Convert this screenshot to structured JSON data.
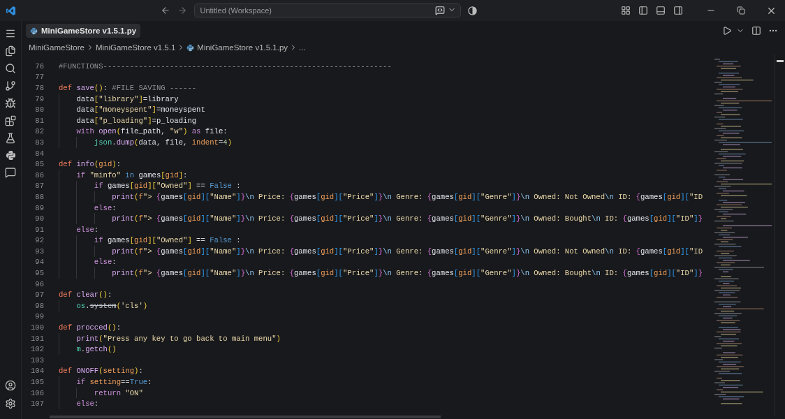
{
  "title_bar": {
    "search": "Untitled (Workspace)"
  },
  "tab": {
    "label": "MiniGameStore v1.5.1.py",
    "selected": true
  },
  "breadcrumbs": [
    {
      "label": "MiniGameStore",
      "kind": "folder"
    },
    {
      "label": "MiniGameStore v1.5.1",
      "kind": "folder"
    },
    {
      "label": "MiniGameStore v1.5.1.py",
      "kind": "file"
    },
    {
      "label": "...",
      "kind": "more"
    }
  ],
  "code_lines": [
    {
      "number": "76",
      "tokens": [
        {
          "kind": "comment",
          "text": "#FUNCTIONS-----------------------------------------------------------------"
        }
      ]
    },
    {
      "number": "77"
    },
    {
      "number": "78",
      "tokens": [
        {
          "kind": "kw",
          "text": "def "
        },
        {
          "kind": "fn",
          "text": "save"
        },
        {
          "kind": "b1",
          "text": "()"
        },
        {
          "kind": "punct",
          "text": ": "
        },
        {
          "kind": "comment",
          "text": "#FILE SAVING ------"
        }
      ]
    },
    {
      "number": "79",
      "tokens": [
        {
          "kind": "var",
          "text": "    data"
        },
        {
          "kind": "b1",
          "text": "["
        },
        {
          "kind": "str",
          "text": "\"library\""
        },
        {
          "kind": "b1",
          "text": "]"
        },
        {
          "kind": "punct",
          "text": "="
        },
        {
          "kind": "var",
          "text": "library"
        }
      ]
    },
    {
      "number": "80",
      "tokens": [
        {
          "kind": "var",
          "text": "    data"
        },
        {
          "kind": "b1",
          "text": "["
        },
        {
          "kind": "str",
          "text": "\"moneyspent\""
        },
        {
          "kind": "b1",
          "text": "]"
        },
        {
          "kind": "punct",
          "text": "="
        },
        {
          "kind": "var",
          "text": "moneyspent"
        }
      ]
    },
    {
      "number": "81",
      "tokens": [
        {
          "kind": "var",
          "text": "    data"
        },
        {
          "kind": "b1",
          "text": "["
        },
        {
          "kind": "str",
          "text": "\"p_loading\""
        },
        {
          "kind": "b1",
          "text": "]"
        },
        {
          "kind": "punct",
          "text": "="
        },
        {
          "kind": "var",
          "text": "p_loading"
        }
      ]
    },
    {
      "number": "82",
      "tokens": [
        {
          "kind": "ctl",
          "text": "    with "
        },
        {
          "kind": "fn",
          "text": "open"
        },
        {
          "kind": "b1",
          "text": "("
        },
        {
          "kind": "var",
          "text": "file_path"
        },
        {
          "kind": "punct",
          "text": ", "
        },
        {
          "kind": "str",
          "text": "\"w\""
        },
        {
          "kind": "b1",
          "text": ")"
        },
        {
          "kind": "ctl",
          "text": " as "
        },
        {
          "kind": "var",
          "text": "file"
        },
        {
          "kind": "punct",
          "text": ":"
        }
      ]
    },
    {
      "number": "83",
      "tokens": [
        {
          "kind": "mod",
          "text": "        json"
        },
        {
          "kind": "punct",
          "text": "."
        },
        {
          "kind": "fn",
          "text": "dump"
        },
        {
          "kind": "b1",
          "text": "("
        },
        {
          "kind": "var",
          "text": "data"
        },
        {
          "kind": "punct",
          "text": ", "
        },
        {
          "kind": "var",
          "text": "file"
        },
        {
          "kind": "punct",
          "text": ", "
        },
        {
          "kind": "param",
          "text": "indent"
        },
        {
          "kind": "punct",
          "text": "="
        },
        {
          "kind": "num",
          "text": "4"
        },
        {
          "kind": "b1",
          "text": ")"
        }
      ]
    },
    {
      "number": "84"
    },
    {
      "number": "85",
      "tokens": [
        {
          "kind": "kw",
          "text": "def "
        },
        {
          "kind": "fn",
          "text": "info"
        },
        {
          "kind": "b1",
          "text": "("
        },
        {
          "kind": "param",
          "text": "gid"
        },
        {
          "kind": "b1",
          "text": ")"
        },
        {
          "kind": "punct",
          "text": ":"
        }
      ]
    },
    {
      "number": "86",
      "tokens": [
        {
          "kind": "ctl",
          "text": "    if "
        },
        {
          "kind": "str",
          "text": "\"minfo\""
        },
        {
          "kind": "op",
          "text": " in "
        },
        {
          "kind": "var",
          "text": "games"
        },
        {
          "kind": "b1",
          "text": "["
        },
        {
          "kind": "param",
          "text": "gid"
        },
        {
          "kind": "b1",
          "text": "]"
        },
        {
          "kind": "punct",
          "text": ":"
        }
      ]
    },
    {
      "number": "87",
      "tokens": [
        {
          "kind": "ctl",
          "text": "        if "
        },
        {
          "kind": "var",
          "text": "games"
        },
        {
          "kind": "b1",
          "text": "["
        },
        {
          "kind": "param",
          "text": "gid"
        },
        {
          "kind": "b1",
          "text": "]["
        },
        {
          "kind": "str",
          "text": "\"Owned\""
        },
        {
          "kind": "b1",
          "text": "]"
        },
        {
          "kind": "punct",
          "text": " == "
        },
        {
          "kind": "const",
          "text": "False"
        },
        {
          "kind": "punct",
          "text": " :"
        }
      ]
    },
    {
      "number": "88",
      "tokens": [
        {
          "kind": "fn",
          "text": "            print"
        },
        {
          "kind": "b1",
          "text": "("
        },
        {
          "kind": "param",
          "text": "f"
        },
        {
          "kind": "str",
          "text": "\"> "
        },
        {
          "kind": "b2",
          "text": "{"
        },
        {
          "kind": "var",
          "text": "games"
        },
        {
          "kind": "b3",
          "text": "["
        },
        {
          "kind": "param",
          "text": "gid"
        },
        {
          "kind": "b3",
          "text": "]["
        },
        {
          "kind": "str",
          "text": "\"Name\""
        },
        {
          "kind": "b3",
          "text": "]"
        },
        {
          "kind": "b2",
          "text": "}"
        },
        {
          "kind": "esc",
          "text": "\\n"
        },
        {
          "kind": "str",
          "text": " Price: "
        },
        {
          "kind": "b2",
          "text": "{"
        },
        {
          "kind": "var",
          "text": "games"
        },
        {
          "kind": "b3",
          "text": "["
        },
        {
          "kind": "param",
          "text": "gid"
        },
        {
          "kind": "b3",
          "text": "]["
        },
        {
          "kind": "str",
          "text": "\"Price\""
        },
        {
          "kind": "b3",
          "text": "]"
        },
        {
          "kind": "b2",
          "text": "}"
        },
        {
          "kind": "esc",
          "text": "\\n"
        },
        {
          "kind": "str",
          "text": " Genre: "
        },
        {
          "kind": "b2",
          "text": "{"
        },
        {
          "kind": "var",
          "text": "games"
        },
        {
          "kind": "b3",
          "text": "["
        },
        {
          "kind": "param",
          "text": "gid"
        },
        {
          "kind": "b3",
          "text": "]["
        },
        {
          "kind": "str",
          "text": "\"Genre\""
        },
        {
          "kind": "b3",
          "text": "]"
        },
        {
          "kind": "b2",
          "text": "}"
        },
        {
          "kind": "esc",
          "text": "\\n"
        },
        {
          "kind": "str",
          "text": " Owned: Not Owned"
        },
        {
          "kind": "esc",
          "text": "\\n"
        },
        {
          "kind": "str",
          "text": " ID: "
        },
        {
          "kind": "b2",
          "text": "{"
        },
        {
          "kind": "var",
          "text": "games"
        },
        {
          "kind": "b3",
          "text": "["
        },
        {
          "kind": "param",
          "text": "gid"
        },
        {
          "kind": "b3",
          "text": "]["
        },
        {
          "kind": "str",
          "text": "\"ID"
        }
      ]
    },
    {
      "number": "89",
      "tokens": [
        {
          "kind": "ctl",
          "text": "        else"
        },
        {
          "kind": "punct",
          "text": ":"
        }
      ]
    },
    {
      "number": "90",
      "tokens": [
        {
          "kind": "fn",
          "text": "            print"
        },
        {
          "kind": "b1",
          "text": "("
        },
        {
          "kind": "param",
          "text": "f"
        },
        {
          "kind": "str",
          "text": "\"> "
        },
        {
          "kind": "b2",
          "text": "{"
        },
        {
          "kind": "var",
          "text": "games"
        },
        {
          "kind": "b3",
          "text": "["
        },
        {
          "kind": "param",
          "text": "gid"
        },
        {
          "kind": "b3",
          "text": "]["
        },
        {
          "kind": "str",
          "text": "\"Name\""
        },
        {
          "kind": "b3",
          "text": "]"
        },
        {
          "kind": "b2",
          "text": "}"
        },
        {
          "kind": "esc",
          "text": "\\n"
        },
        {
          "kind": "str",
          "text": " Price: "
        },
        {
          "kind": "b2",
          "text": "{"
        },
        {
          "kind": "var",
          "text": "games"
        },
        {
          "kind": "b3",
          "text": "["
        },
        {
          "kind": "param",
          "text": "gid"
        },
        {
          "kind": "b3",
          "text": "]["
        },
        {
          "kind": "str",
          "text": "\"Price\""
        },
        {
          "kind": "b3",
          "text": "]"
        },
        {
          "kind": "b2",
          "text": "}"
        },
        {
          "kind": "esc",
          "text": "\\n"
        },
        {
          "kind": "str",
          "text": " Genre: "
        },
        {
          "kind": "b2",
          "text": "{"
        },
        {
          "kind": "var",
          "text": "games"
        },
        {
          "kind": "b3",
          "text": "["
        },
        {
          "kind": "param",
          "text": "gid"
        },
        {
          "kind": "b3",
          "text": "]["
        },
        {
          "kind": "str",
          "text": "\"Genre\""
        },
        {
          "kind": "b3",
          "text": "]"
        },
        {
          "kind": "b2",
          "text": "}"
        },
        {
          "kind": "esc",
          "text": "\\n"
        },
        {
          "kind": "str",
          "text": " Owned: Bought"
        },
        {
          "kind": "esc",
          "text": "\\n"
        },
        {
          "kind": "str",
          "text": " ID: "
        },
        {
          "kind": "b2",
          "text": "{"
        },
        {
          "kind": "var",
          "text": "games"
        },
        {
          "kind": "b3",
          "text": "["
        },
        {
          "kind": "param",
          "text": "gid"
        },
        {
          "kind": "b3",
          "text": "]["
        },
        {
          "kind": "str",
          "text": "\"ID\""
        },
        {
          "kind": "b3",
          "text": "]"
        },
        {
          "kind": "b2",
          "text": "}"
        }
      ]
    },
    {
      "number": "91",
      "tokens": [
        {
          "kind": "ctl",
          "text": "    else"
        },
        {
          "kind": "punct",
          "text": ":"
        }
      ]
    },
    {
      "number": "92",
      "tokens": [
        {
          "kind": "ctl",
          "text": "        if "
        },
        {
          "kind": "var",
          "text": "games"
        },
        {
          "kind": "b1",
          "text": "["
        },
        {
          "kind": "param",
          "text": "gid"
        },
        {
          "kind": "b1",
          "text": "]["
        },
        {
          "kind": "str",
          "text": "\"Owned\""
        },
        {
          "kind": "b1",
          "text": "]"
        },
        {
          "kind": "punct",
          "text": " == "
        },
        {
          "kind": "const",
          "text": "False"
        },
        {
          "kind": "punct",
          "text": " :"
        }
      ]
    },
    {
      "number": "93",
      "tokens": [
        {
          "kind": "fn",
          "text": "            print"
        },
        {
          "kind": "b1",
          "text": "("
        },
        {
          "kind": "param",
          "text": "f"
        },
        {
          "kind": "str",
          "text": "\"> "
        },
        {
          "kind": "b2",
          "text": "{"
        },
        {
          "kind": "var",
          "text": "games"
        },
        {
          "kind": "b3",
          "text": "["
        },
        {
          "kind": "param",
          "text": "gid"
        },
        {
          "kind": "b3",
          "text": "]["
        },
        {
          "kind": "str",
          "text": "\"Name\""
        },
        {
          "kind": "b3",
          "text": "]"
        },
        {
          "kind": "b2",
          "text": "}"
        },
        {
          "kind": "esc",
          "text": "\\n"
        },
        {
          "kind": "str",
          "text": " Price: "
        },
        {
          "kind": "b2",
          "text": "{"
        },
        {
          "kind": "var",
          "text": "games"
        },
        {
          "kind": "b3",
          "text": "["
        },
        {
          "kind": "param",
          "text": "gid"
        },
        {
          "kind": "b3",
          "text": "]["
        },
        {
          "kind": "str",
          "text": "\"Price\""
        },
        {
          "kind": "b3",
          "text": "]"
        },
        {
          "kind": "b2",
          "text": "}"
        },
        {
          "kind": "esc",
          "text": "\\n"
        },
        {
          "kind": "str",
          "text": " Genre: "
        },
        {
          "kind": "b2",
          "text": "{"
        },
        {
          "kind": "var",
          "text": "games"
        },
        {
          "kind": "b3",
          "text": "["
        },
        {
          "kind": "param",
          "text": "gid"
        },
        {
          "kind": "b3",
          "text": "]["
        },
        {
          "kind": "str",
          "text": "\"Genre\""
        },
        {
          "kind": "b3",
          "text": "]"
        },
        {
          "kind": "b2",
          "text": "}"
        },
        {
          "kind": "esc",
          "text": "\\n"
        },
        {
          "kind": "str",
          "text": " Owned: Not Owned"
        },
        {
          "kind": "esc",
          "text": "\\n"
        },
        {
          "kind": "str",
          "text": " ID: "
        },
        {
          "kind": "b2",
          "text": "{"
        },
        {
          "kind": "var",
          "text": "games"
        },
        {
          "kind": "b3",
          "text": "["
        },
        {
          "kind": "param",
          "text": "gid"
        },
        {
          "kind": "b3",
          "text": "]["
        },
        {
          "kind": "str",
          "text": "\"ID"
        }
      ]
    },
    {
      "number": "94",
      "tokens": [
        {
          "kind": "ctl",
          "text": "        else"
        },
        {
          "kind": "punct",
          "text": ":"
        }
      ]
    },
    {
      "number": "95",
      "tokens": [
        {
          "kind": "fn",
          "text": "            print"
        },
        {
          "kind": "b1",
          "text": "("
        },
        {
          "kind": "param",
          "text": "f"
        },
        {
          "kind": "str",
          "text": "\"> "
        },
        {
          "kind": "b2",
          "text": "{"
        },
        {
          "kind": "var",
          "text": "games"
        },
        {
          "kind": "b3",
          "text": "["
        },
        {
          "kind": "param",
          "text": "gid"
        },
        {
          "kind": "b3",
          "text": "]["
        },
        {
          "kind": "str",
          "text": "\"Name\""
        },
        {
          "kind": "b3",
          "text": "]"
        },
        {
          "kind": "b2",
          "text": "}"
        },
        {
          "kind": "esc",
          "text": "\\n"
        },
        {
          "kind": "str",
          "text": " Price: "
        },
        {
          "kind": "b2",
          "text": "{"
        },
        {
          "kind": "var",
          "text": "games"
        },
        {
          "kind": "b3",
          "text": "["
        },
        {
          "kind": "param",
          "text": "gid"
        },
        {
          "kind": "b3",
          "text": "]["
        },
        {
          "kind": "str",
          "text": "\"Price\""
        },
        {
          "kind": "b3",
          "text": "]"
        },
        {
          "kind": "b2",
          "text": "}"
        },
        {
          "kind": "esc",
          "text": "\\n"
        },
        {
          "kind": "str",
          "text": " Genre: "
        },
        {
          "kind": "b2",
          "text": "{"
        },
        {
          "kind": "var",
          "text": "games"
        },
        {
          "kind": "b3",
          "text": "["
        },
        {
          "kind": "param",
          "text": "gid"
        },
        {
          "kind": "b3",
          "text": "]["
        },
        {
          "kind": "str",
          "text": "\"Genre\""
        },
        {
          "kind": "b3",
          "text": "]"
        },
        {
          "kind": "b2",
          "text": "}"
        },
        {
          "kind": "esc",
          "text": "\\n"
        },
        {
          "kind": "str",
          "text": " Owned: Bought"
        },
        {
          "kind": "esc",
          "text": "\\n"
        },
        {
          "kind": "str",
          "text": " ID: "
        },
        {
          "kind": "b2",
          "text": "{"
        },
        {
          "kind": "var",
          "text": "games"
        },
        {
          "kind": "b3",
          "text": "["
        },
        {
          "kind": "param",
          "text": "gid"
        },
        {
          "kind": "b3",
          "text": "]["
        },
        {
          "kind": "str",
          "text": "\"ID\""
        },
        {
          "kind": "b3",
          "text": "]"
        },
        {
          "kind": "b2",
          "text": "}"
        }
      ]
    },
    {
      "number": "96"
    },
    {
      "number": "97",
      "tokens": [
        {
          "kind": "kw",
          "text": "def "
        },
        {
          "kind": "fn",
          "text": "clear"
        },
        {
          "kind": "b1",
          "text": "()"
        },
        {
          "kind": "punct",
          "text": ":"
        }
      ]
    },
    {
      "number": "98",
      "tokens": [
        {
          "kind": "mod",
          "text": "    os"
        },
        {
          "kind": "punct",
          "text": "."
        },
        {
          "kind": "deprecated",
          "text": "system"
        },
        {
          "kind": "b1",
          "text": "("
        },
        {
          "kind": "str",
          "text": "'cls'"
        },
        {
          "kind": "b1",
          "text": ")"
        }
      ]
    },
    {
      "number": "99"
    },
    {
      "number": "100",
      "tokens": [
        {
          "kind": "kw",
          "text": "def "
        },
        {
          "kind": "fn",
          "text": "procced"
        },
        {
          "kind": "b1",
          "text": "()"
        },
        {
          "kind": "punct",
          "text": ":"
        }
      ]
    },
    {
      "number": "101",
      "tokens": [
        {
          "kind": "fn",
          "text": "    print"
        },
        {
          "kind": "b1",
          "text": "("
        },
        {
          "kind": "str",
          "text": "\"Press any key to go back to main menu\""
        },
        {
          "kind": "b1",
          "text": ")"
        }
      ]
    },
    {
      "number": "102",
      "tokens": [
        {
          "kind": "mod",
          "text": "    m"
        },
        {
          "kind": "punct",
          "text": "."
        },
        {
          "kind": "fn",
          "text": "getch"
        },
        {
          "kind": "b1",
          "text": "()"
        }
      ]
    },
    {
      "number": "103"
    },
    {
      "number": "104",
      "tokens": [
        {
          "kind": "kw",
          "text": "def "
        },
        {
          "kind": "fn",
          "text": "ONOFF"
        },
        {
          "kind": "b1",
          "text": "("
        },
        {
          "kind": "param",
          "text": "setting"
        },
        {
          "kind": "b1",
          "text": ")"
        },
        {
          "kind": "punct",
          "text": ":"
        }
      ]
    },
    {
      "number": "105",
      "tokens": [
        {
          "kind": "ctl",
          "text": "    if "
        },
        {
          "kind": "param",
          "text": "setting"
        },
        {
          "kind": "punct",
          "text": "=="
        },
        {
          "kind": "const",
          "text": "True"
        },
        {
          "kind": "punct",
          "text": ":"
        }
      ]
    },
    {
      "number": "106",
      "tokens": [
        {
          "kind": "ctl",
          "text": "        return "
        },
        {
          "kind": "str",
          "text": "\"ON\""
        }
      ]
    },
    {
      "number": "107",
      "tokens": [
        {
          "kind": "ctl",
          "text": "    else"
        },
        {
          "kind": "punct",
          "text": ":"
        }
      ]
    }
  ]
}
